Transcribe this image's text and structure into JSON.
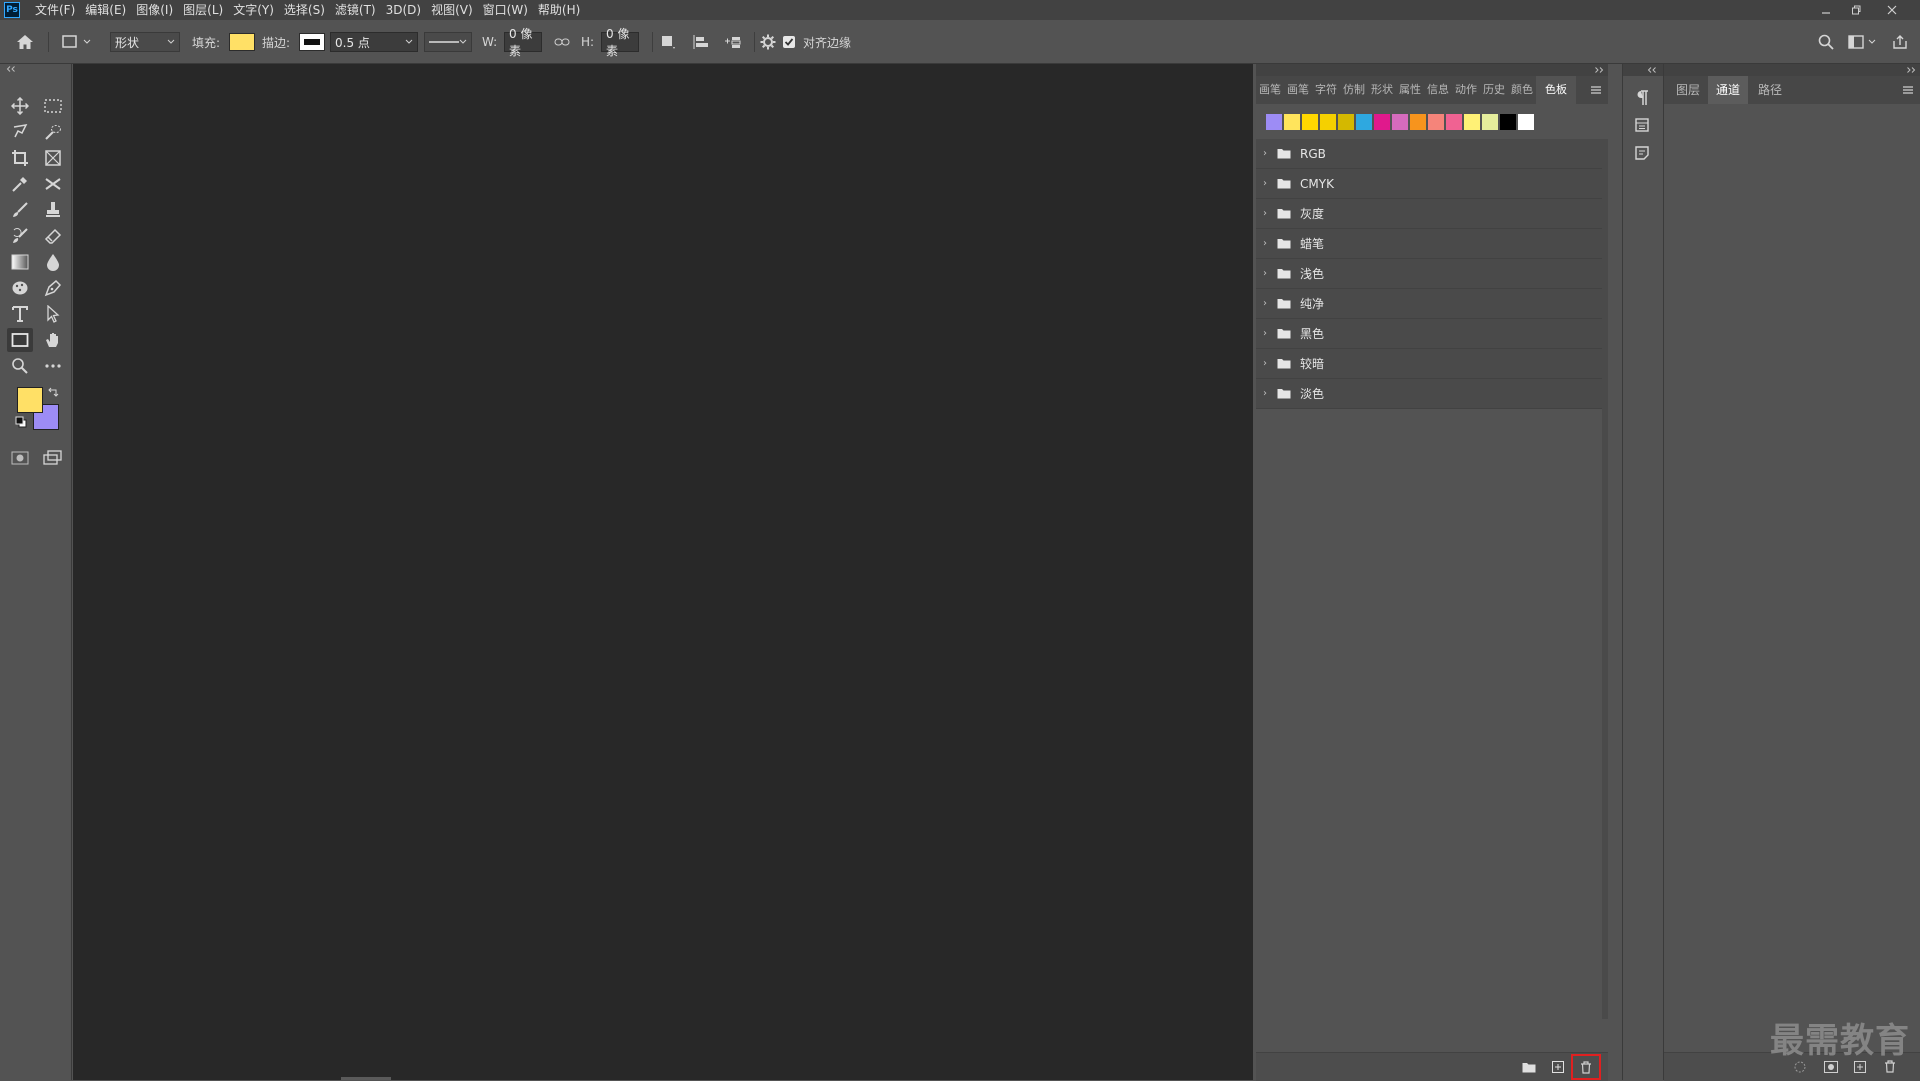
{
  "app": {
    "logo_text": "Ps"
  },
  "menu": [
    "文件(F)",
    "编辑(E)",
    "图像(I)",
    "图层(L)",
    "文字(Y)",
    "选择(S)",
    "滤镜(T)",
    "3D(D)",
    "视图(V)",
    "窗口(W)",
    "帮助(H)"
  ],
  "options": {
    "mode_value": "形状",
    "fill_label": "填充:",
    "fill_color": "#ffe066",
    "stroke_label": "描边:",
    "stroke_width": "0.5 点",
    "w_label": "W:",
    "w_value": "0 像素",
    "h_label": "H:",
    "h_value": "0 像素",
    "align_edges_label": "对齐边缘",
    "align_edges_checked": true
  },
  "colors": {
    "foreground": "#ffe066",
    "background": "#9d8cf5",
    "accent_highlight": "#e02020"
  },
  "swatches_panel": {
    "tabs": [
      "画笔",
      "画笔",
      "字符",
      "仿制",
      "形状",
      "属性",
      "信息",
      "动作",
      "历史",
      "颜色",
      "色板"
    ],
    "active_tab": "色板",
    "recent_swatches": [
      "#9d8cf5",
      "#ffe45c",
      "#ffd700",
      "#f5d000",
      "#d4b800",
      "#2ea8e0",
      "#e0198c",
      "#d66bbd",
      "#f7941d",
      "#f5847a",
      "#f06292",
      "#fff176",
      "#e6ee9c",
      "#000000",
      "#ffffff"
    ],
    "groups": [
      "RGB",
      "CMYK",
      "灰度",
      "蜡笔",
      "浅色",
      "纯净",
      "黑色",
      "较暗",
      "淡色"
    ]
  },
  "channels_panel": {
    "tabs": [
      "图层",
      "通道",
      "路径"
    ],
    "active_tab": "通道"
  },
  "watermark": "最需教育"
}
